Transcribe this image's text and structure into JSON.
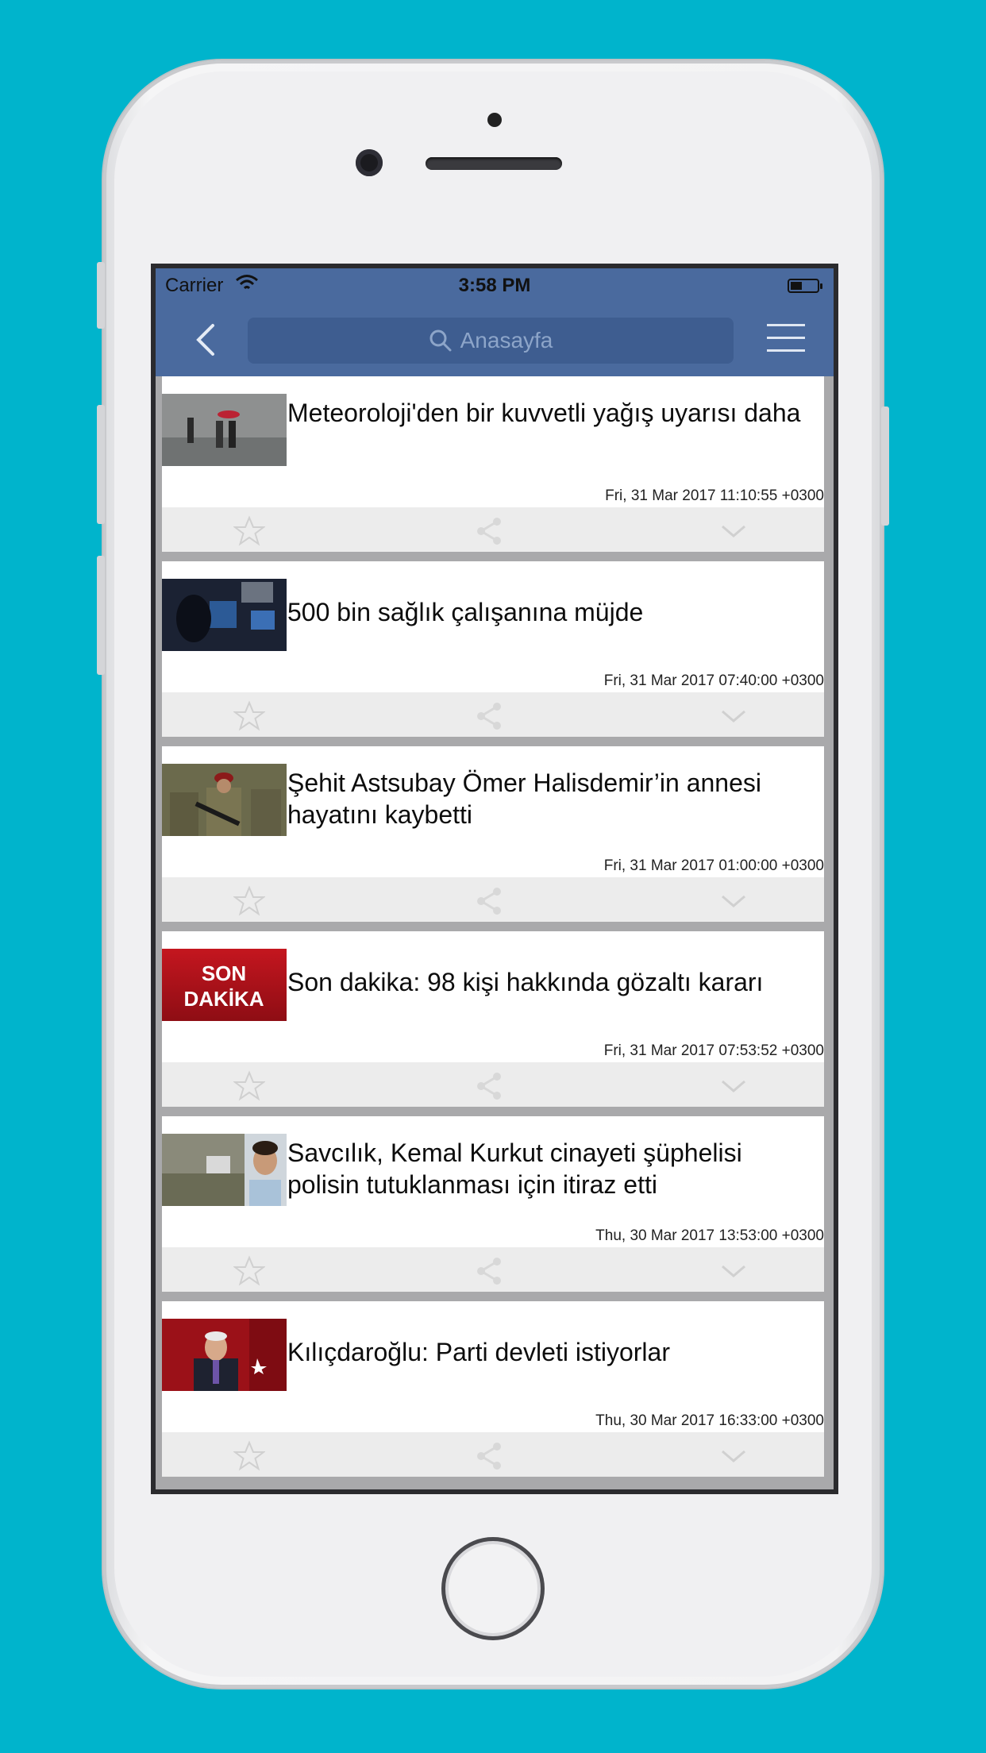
{
  "status": {
    "carrier": "Carrier",
    "time": "3:58 PM"
  },
  "search": {
    "placeholder": "Anasayfa"
  },
  "articles": [
    {
      "title": "Meteoroloji'den bir kuvvetli yağış uyarısı daha",
      "date": "Fri, 31 Mar 2017 11:10:55 +0300"
    },
    {
      "title": "500 bin sağlık çalışanına müjde",
      "date": "Fri, 31 Mar 2017 07:40:00 +0300"
    },
    {
      "title": "Şehit Astsubay Ömer Halisdemir’in annesi hayatını kaybetti",
      "date": "Fri, 31 Mar 2017 01:00:00 +0300"
    },
    {
      "title": "Son dakika: 98 kişi hakkında gözaltı kararı",
      "date": "Fri, 31 Mar 2017 07:53:52 +0300",
      "thumb_text": [
        "SON",
        "DAKİKA"
      ]
    },
    {
      "title": "Savcılık, Kemal Kurkut cinayeti şüphelisi polisin tutuklanması için itiraz etti",
      "date": "Thu, 30 Mar 2017 13:53:00 +0300"
    },
    {
      "title": "Kılıçdaroğlu: Parti devleti istiyorlar",
      "date": "Thu, 30 Mar 2017 16:33:00 +0300"
    }
  ],
  "colors": {
    "background": "#00b4cc",
    "navbar": "#4a6a9e",
    "search_field": "#3e5d90",
    "son_dakika_red": "#b0141c"
  },
  "icons": {
    "back": "chevron-left-icon",
    "search": "search-icon",
    "menu": "hamburger-menu-icon",
    "favorite": "star-icon",
    "share": "share-icon",
    "expand": "chevron-down-icon"
  }
}
